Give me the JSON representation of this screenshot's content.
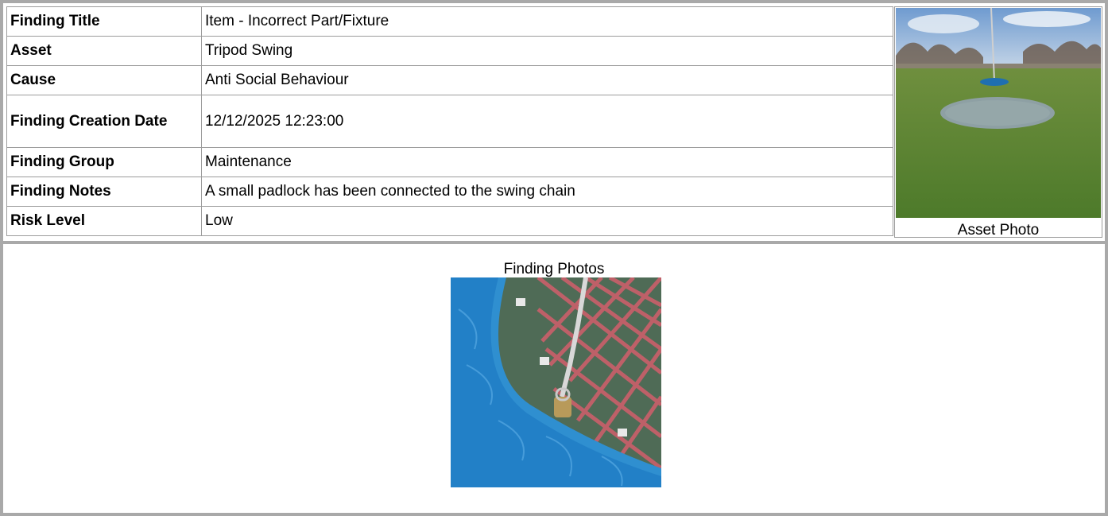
{
  "details": [
    {
      "label": "Finding Title",
      "value": "Item - Incorrect Part/Fixture"
    },
    {
      "label": "Asset",
      "value": "Tripod Swing"
    },
    {
      "label": "Cause",
      "value": "Anti Social Behaviour"
    },
    {
      "label": "Finding Creation Date",
      "value": "12/12/2025 12:23:00"
    },
    {
      "label": "Finding Group",
      "value": "Maintenance"
    },
    {
      "label": "Finding Notes",
      "value": "A small padlock has been connected to the swing chain"
    },
    {
      "label": "Risk Level",
      "value": "Low"
    }
  ],
  "asset_photo": {
    "caption": "Asset Photo"
  },
  "findings": {
    "title": "Finding Photos"
  },
  "colors": {
    "border": "#a9a9a9",
    "cell_border": "#9c9c9c"
  }
}
